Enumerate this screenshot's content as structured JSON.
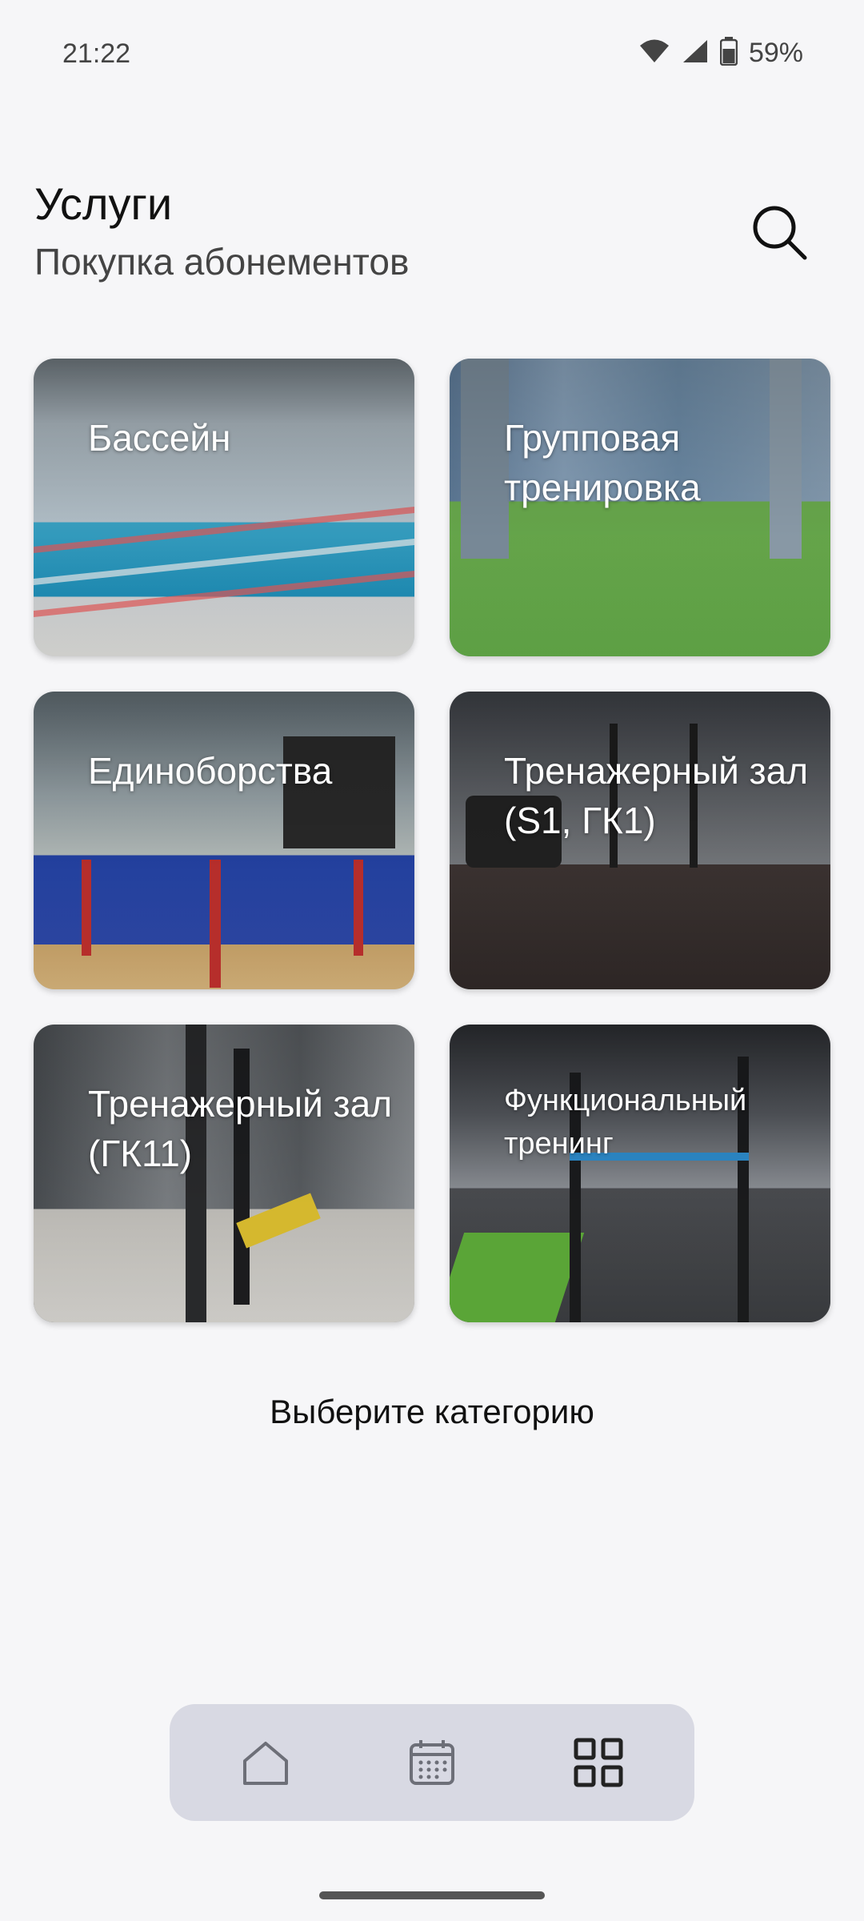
{
  "status_bar": {
    "time": "21:22",
    "battery_percent": "59%",
    "icons": [
      "wifi-icon",
      "signal-icon",
      "battery-icon"
    ]
  },
  "header": {
    "title": "Услуги",
    "subtitle": "Покупка абонементов",
    "search_icon": "search-icon"
  },
  "categories": [
    {
      "label": "Бассейн"
    },
    {
      "label": "Групповая тренировка"
    },
    {
      "label": "Единоборства"
    },
    {
      "label": "Тренажерный зал (S1, ГК1)"
    },
    {
      "label": "Тренажерный зал (ГК11)"
    },
    {
      "label": "Функциональный тренинг"
    }
  ],
  "hint": "Выберите категорию",
  "bottom_nav": {
    "items": [
      {
        "icon": "home-icon",
        "active": false
      },
      {
        "icon": "calendar-icon",
        "active": false
      },
      {
        "icon": "grid-icon",
        "active": true
      }
    ]
  },
  "colors": {
    "background": "#f6f6f8",
    "nav_background": "#d8d9e3",
    "nav_inactive": "#6d6f78",
    "nav_active": "#222222"
  }
}
